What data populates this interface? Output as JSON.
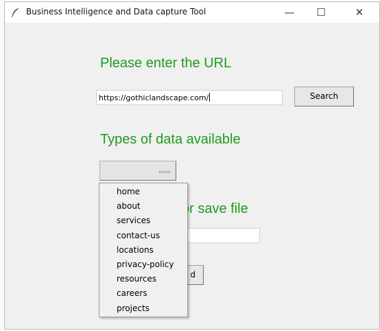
{
  "window": {
    "title": "Business Intelligence and Data capture Tool",
    "controls": {
      "minimize": "—",
      "maximize": "☐",
      "close": "✕"
    }
  },
  "url_section": {
    "heading": "Please enter the URL",
    "input_value": "https://gothiclandscape.com/",
    "search_label": "Search"
  },
  "types_section": {
    "heading": "Types of data available",
    "selected_value": ""
  },
  "save_section": {
    "heading_visible": "or save file",
    "input_value": "",
    "button_label_visible": "d"
  },
  "dropdown": {
    "items": [
      "home",
      "about",
      "services",
      "contact-us",
      "locations",
      "privacy-policy",
      "resources",
      "careers",
      "projects"
    ]
  },
  "colors": {
    "heading_green": "#1e9b1e",
    "window_bg": "#f0f0f0"
  },
  "icons": {
    "app": "feather-icon"
  }
}
